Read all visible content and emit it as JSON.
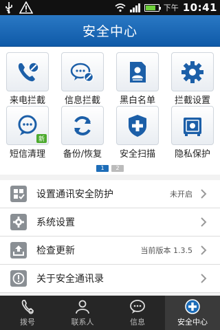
{
  "status_bar": {
    "ampm": "下午",
    "time": "10:41",
    "battery_level": 0.8
  },
  "header": {
    "title": "安全中心"
  },
  "grid": {
    "items": [
      {
        "label": "来电拦截",
        "icon": "call-block-icon"
      },
      {
        "label": "信息拦截",
        "icon": "message-block-icon"
      },
      {
        "label": "黑白名单",
        "icon": "contact-list-icon"
      },
      {
        "label": "拦截设置",
        "icon": "gear-icon"
      },
      {
        "label": "短信清理",
        "icon": "sms-clean-icon",
        "badge": "新"
      },
      {
        "label": "备份/恢复",
        "icon": "sync-icon"
      },
      {
        "label": "安全扫描",
        "icon": "shield-plus-icon"
      },
      {
        "label": "隐私保护",
        "icon": "safe-icon"
      }
    ],
    "pager": {
      "page1": "1",
      "page2": "2",
      "current": 1
    }
  },
  "settings_list": [
    {
      "label": "设置通讯安全防护",
      "value": "未开启",
      "icon": "security-setup-icon"
    },
    {
      "label": "系统设置",
      "value": "",
      "icon": "gear-icon"
    },
    {
      "label": "检查更新",
      "value": "当前版本 1.3.5",
      "icon": "upload-icon"
    },
    {
      "label": "关于安全通讯录",
      "value": "",
      "icon": "info-icon"
    }
  ],
  "bottom_nav": [
    {
      "label": "拨号",
      "icon": "phone-icon"
    },
    {
      "label": "联系人",
      "icon": "person-icon"
    },
    {
      "label": "信息",
      "icon": "chat-icon"
    },
    {
      "label": "安全中心",
      "icon": "shield-cross-icon",
      "active": true
    }
  ],
  "colors": {
    "accent": "#1d6db8",
    "icon_blue": "#1c5fa8",
    "new_badge": "#4caa2e",
    "nav_bg": "#262626"
  }
}
